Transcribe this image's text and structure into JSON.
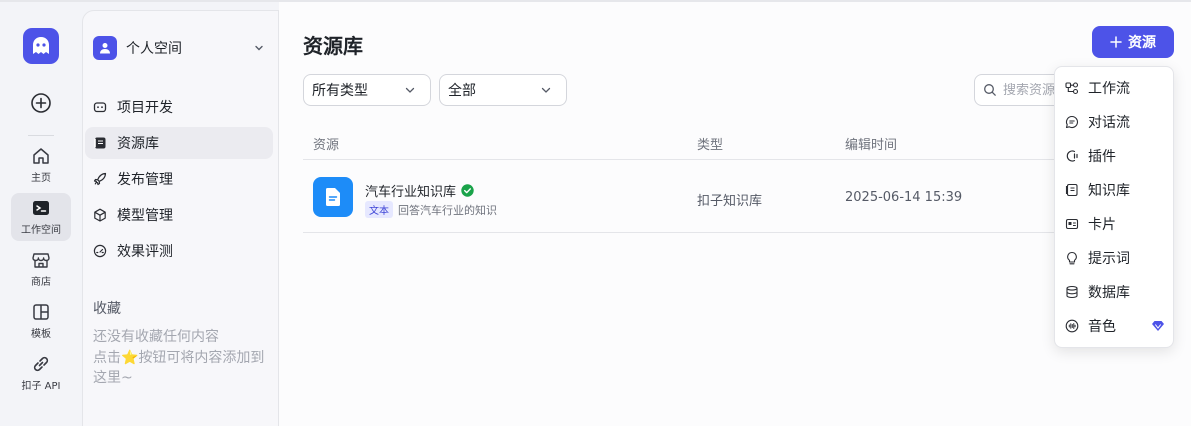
{
  "rail": {
    "items": [
      {
        "label": "主页",
        "icon": "home-icon"
      },
      {
        "label": "工作空间",
        "icon": "terminal-icon"
      },
      {
        "label": "商店",
        "icon": "store-icon"
      },
      {
        "label": "模板",
        "icon": "template-icon"
      },
      {
        "label": "扣子 API",
        "icon": "link-icon"
      }
    ],
    "active_index": 1
  },
  "sidebar": {
    "space_name": "个人空间",
    "items": [
      {
        "label": "项目开发",
        "icon": "robot-icon"
      },
      {
        "label": "资源库",
        "icon": "library-icon"
      },
      {
        "label": "发布管理",
        "icon": "rocket-icon"
      },
      {
        "label": "模型管理",
        "icon": "cube-icon"
      },
      {
        "label": "效果评测",
        "icon": "gauge-icon"
      }
    ],
    "active_index": 1,
    "favorites_title": "收藏",
    "favorites_hint_1": "还没有收藏任何内容",
    "favorites_hint_2": "点击",
    "favorites_hint_star": "⭐",
    "favorites_hint_3": "按钮可将内容添加到这里~"
  },
  "main": {
    "title": "资源库",
    "add_button": "资源",
    "type_filter": "所有类型",
    "scope_filter": "全部",
    "search_placeholder": "搜索资源",
    "columns": [
      "资源",
      "类型",
      "编辑时间"
    ],
    "rows": [
      {
        "name": "汽车行业知识库",
        "tag": "文本",
        "description": "回答汽车行业的知识",
        "type": "扣子知识库",
        "edited": "2025-06-14 15:39"
      }
    ]
  },
  "dropdown": {
    "items": [
      {
        "label": "工作流",
        "icon": "workflow-icon"
      },
      {
        "label": "对话流",
        "icon": "chatflow-icon"
      },
      {
        "label": "插件",
        "icon": "plugin-icon"
      },
      {
        "label": "知识库",
        "icon": "knowledge-icon"
      },
      {
        "label": "卡片",
        "icon": "card-icon"
      },
      {
        "label": "提示词",
        "icon": "prompt-icon"
      },
      {
        "label": "数据库",
        "icon": "database-icon"
      },
      {
        "label": "音色",
        "icon": "voice-icon",
        "premium": true
      }
    ]
  },
  "colors": {
    "accent": "#4d53e8",
    "doc_icon": "#1d8cf8",
    "verified": "#1aa34a"
  }
}
